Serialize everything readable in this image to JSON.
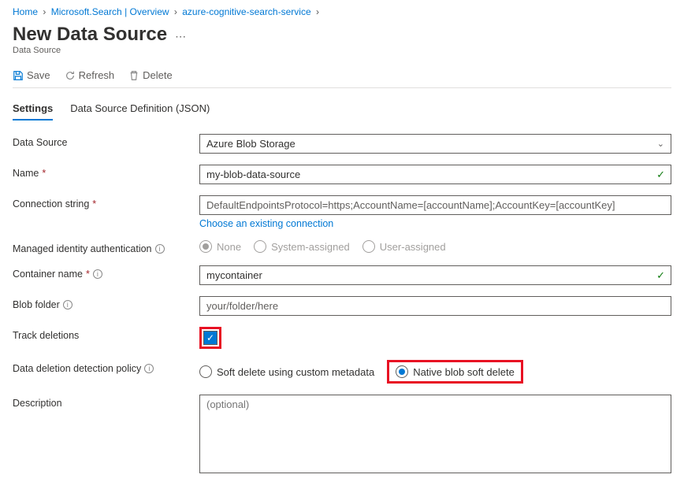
{
  "breadcrumb": {
    "items": [
      "Home",
      "Microsoft.Search | Overview",
      "azure-cognitive-search-service"
    ]
  },
  "header": {
    "title": "New Data Source",
    "subtitle": "Data Source"
  },
  "commands": {
    "save": "Save",
    "refresh": "Refresh",
    "delete": "Delete"
  },
  "tabs": {
    "settings": "Settings",
    "json": "Data Source Definition (JSON)"
  },
  "form": {
    "dataSourceLabel": "Data Source",
    "dataSourceValue": "Azure Blob Storage",
    "nameLabel": "Name",
    "nameValue": "my-blob-data-source",
    "connLabel": "Connection string",
    "connValue": "DefaultEndpointsProtocol=https;AccountName=[accountName];AccountKey=[accountKey]",
    "connLink": "Choose an existing connection",
    "miLabel": "Managed identity authentication",
    "miOptions": {
      "none": "None",
      "system": "System-assigned",
      "user": "User-assigned"
    },
    "containerLabel": "Container name",
    "containerValue": "mycontainer",
    "blobFolderLabel": "Blob folder",
    "blobFolderValue": "your/folder/here",
    "trackLabel": "Track deletions",
    "policyLabel": "Data deletion detection policy",
    "policyOptions": {
      "soft": "Soft delete using custom metadata",
      "native": "Native blob soft delete"
    },
    "descLabel": "Description",
    "descPlaceholder": "(optional)"
  }
}
